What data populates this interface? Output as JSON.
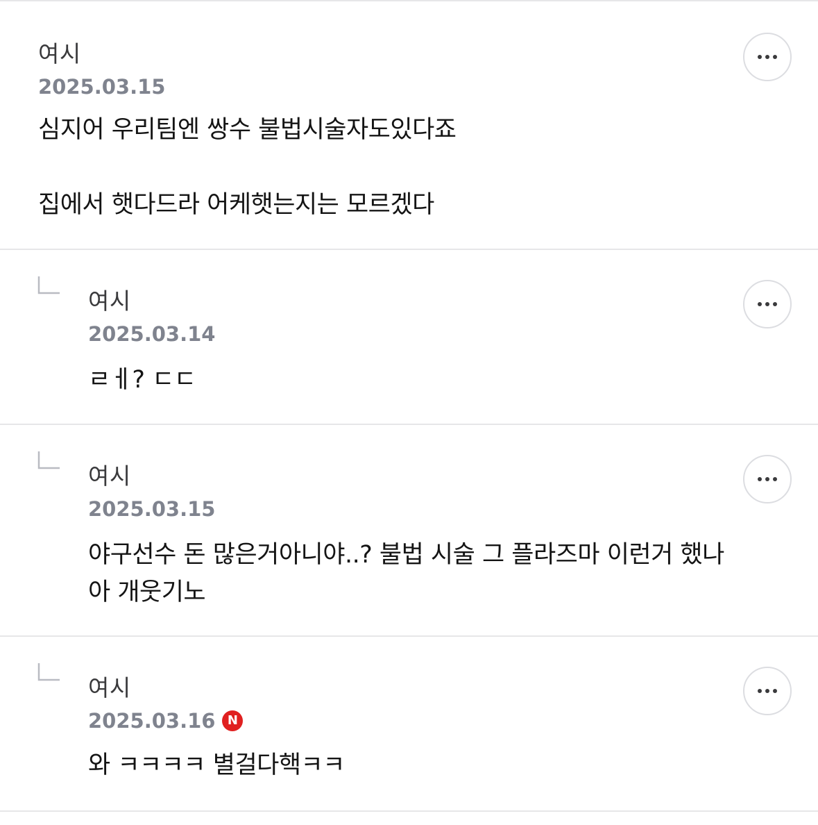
{
  "comments": [
    {
      "author": "여시",
      "date": "2025.03.15",
      "text": "심지어 우리팀엔 쌍수 불법시술자도있다죠\n\n집에서 햇다드라 어케햇는지는 모르겠다",
      "is_reply": false,
      "more_icon": "ellipsis-icon"
    },
    {
      "author": "여시",
      "date": "2025.03.14",
      "text": "ㄹㅔ? ㄷㄷ",
      "is_reply": true,
      "more_icon": "ellipsis-icon"
    },
    {
      "author": "여시",
      "date": "2025.03.15",
      "text": "야구선수 돈 많은거아니야..? 불법 시술 그 플라즈마 이런거 했나\n아 개웃기노",
      "is_reply": true,
      "more_icon": "ellipsis-icon"
    },
    {
      "author": "여시",
      "date": "2025.03.16",
      "badge": "N",
      "text": "와 ㅋㅋㅋㅋ 별걸다핵ㅋㅋ",
      "is_reply": true,
      "more_icon": "ellipsis-icon"
    }
  ],
  "colors": {
    "date": "#7f838e",
    "author": "#3a3a3c",
    "divider": "#e6e6e8",
    "new_badge": "#e02020"
  }
}
